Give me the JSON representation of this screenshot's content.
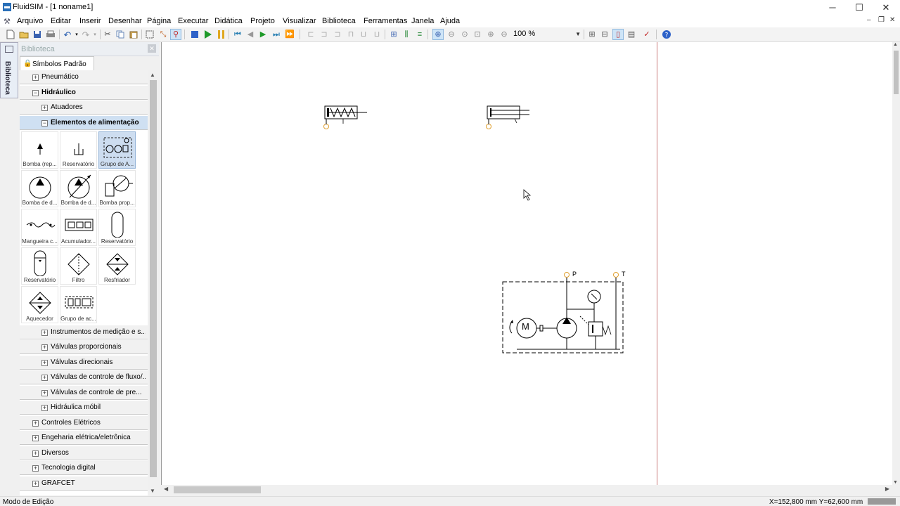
{
  "window": {
    "title": "FluidSIM - [1  noname1]",
    "controls": [
      "─",
      "☐",
      "✕"
    ]
  },
  "menubar": {
    "items": [
      "Arquivo",
      "Editar",
      "Inserir",
      "Desenhar",
      "Página",
      "Executar",
      "Didática",
      "Projeto",
      "Visualizar",
      "Biblioteca",
      "Ferramentas",
      "Janela",
      "Ajuda"
    ],
    "mdi_controls": [
      "–",
      "❐",
      "✕"
    ]
  },
  "toolbar": {
    "zoom": "100 %"
  },
  "sidebar_tab": {
    "label": "Biblioteca"
  },
  "library": {
    "header": "Biblioteca",
    "tab": "Símbolos Padrão",
    "tree_top": [
      {
        "label": "Pneumático",
        "sign": "+",
        "level": 1,
        "selected": false,
        "bold": false
      },
      {
        "label": "Hidráulico",
        "sign": "−",
        "level": 1,
        "selected": false,
        "bold": true
      },
      {
        "label": "Atuadores",
        "sign": "+",
        "level": 2,
        "selected": false,
        "bold": false
      },
      {
        "label": "Elementos de alimentação",
        "sign": "−",
        "level": 2,
        "selected": true,
        "bold": true
      }
    ],
    "symbols": [
      {
        "caption": "Bomba (rep...",
        "icon": "pump-simple-icon",
        "selected": false
      },
      {
        "caption": "Reservatório",
        "icon": "reservoir-symbol-icon",
        "selected": false
      },
      {
        "caption": "Grupo de A...",
        "icon": "power-unit-icon",
        "selected": true
      },
      {
        "caption": "Bomba de d...",
        "icon": "fixed-pump-icon",
        "selected": false
      },
      {
        "caption": "Bomba de d...",
        "icon": "variable-pump-icon",
        "selected": false
      },
      {
        "caption": "Bomba prop...",
        "icon": "proportional-pump-icon",
        "selected": false
      },
      {
        "caption": "Mangueira c...",
        "icon": "hose-icon",
        "selected": false
      },
      {
        "caption": "Acumulador...",
        "icon": "accumulator-circuit-icon",
        "selected": false
      },
      {
        "caption": "Reservatório",
        "icon": "tank-capsule-icon",
        "selected": false
      },
      {
        "caption": "Reservatório",
        "icon": "tank-capsule-down-icon",
        "selected": false
      },
      {
        "caption": "Filtro",
        "icon": "filter-icon",
        "selected": false
      },
      {
        "caption": "Resfriador",
        "icon": "cooler-icon",
        "selected": false
      },
      {
        "caption": "Aquecedor",
        "icon": "heater-icon",
        "selected": false
      },
      {
        "caption": "Grupo de ac...",
        "icon": "accumulator-group-icon",
        "selected": false
      }
    ],
    "tree_bottom": [
      {
        "label": "Instrumentos de medição e s...",
        "sign": "+",
        "level": 2
      },
      {
        "label": "Válvulas proporcionais",
        "sign": "+",
        "level": 2
      },
      {
        "label": "Válvulas direcionais",
        "sign": "+",
        "level": 2
      },
      {
        "label": "Válvulas de controle de fluxo/...",
        "sign": "+",
        "level": 2
      },
      {
        "label": "Válvulas de controle de pre...",
        "sign": "+",
        "level": 2
      },
      {
        "label": "Hidráulica móbil",
        "sign": "+",
        "level": 2
      },
      {
        "label": "Controles Elétricos",
        "sign": "+",
        "level": 1
      },
      {
        "label": "Engeharia elétrica/eletrônica",
        "sign": "+",
        "level": 1
      },
      {
        "label": "Diversos",
        "sign": "+",
        "level": 1
      },
      {
        "label": "Tecnologia digital",
        "sign": "+",
        "level": 1
      },
      {
        "label": "GRAFCET",
        "sign": "+",
        "level": 1
      }
    ]
  },
  "canvas": {
    "port_labels": {
      "pressure": "P",
      "tank": "T"
    },
    "motor_label": "M"
  },
  "statusbar": {
    "mode": "Modo de Edição",
    "coords": "X=152,800 mm  Y=62,600 mm"
  },
  "colors": {
    "page_border": "#c97b7b",
    "selection": "#cfe0f2",
    "port": "#e0a030"
  }
}
